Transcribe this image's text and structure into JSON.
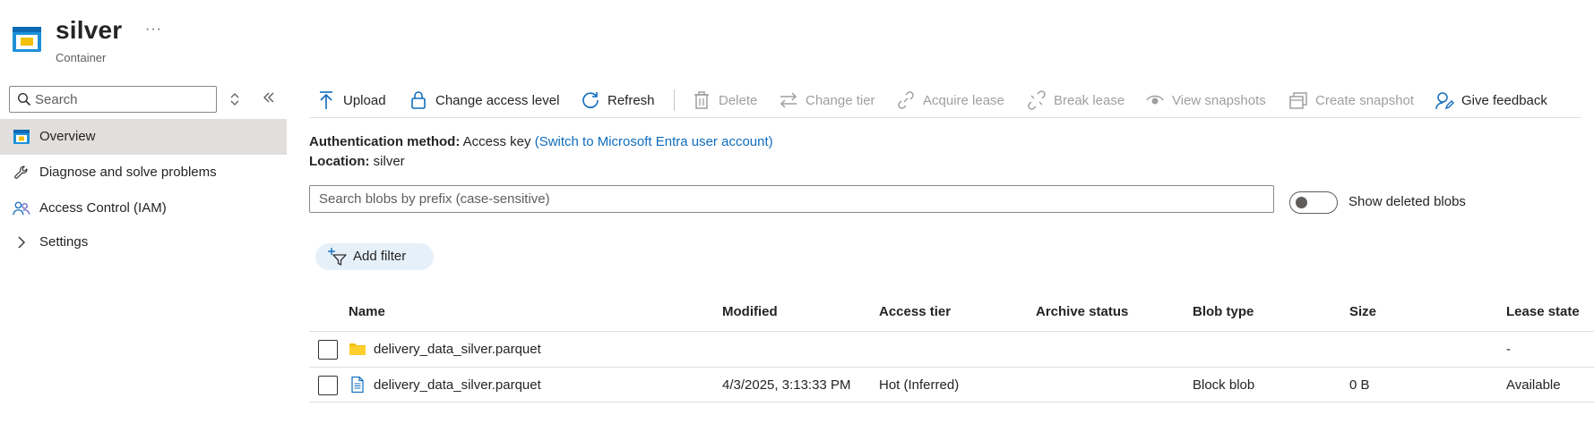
{
  "header": {
    "title": "silver",
    "subtitle": "Container",
    "more": "···"
  },
  "sidebar": {
    "search_placeholder": "Search",
    "items": [
      {
        "label": "Overview",
        "icon": "container-icon",
        "active": true
      },
      {
        "label": "Diagnose and solve problems",
        "icon": "wrench-icon"
      },
      {
        "label": "Access Control (IAM)",
        "icon": "people-icon"
      },
      {
        "label": "Settings",
        "icon": "chevron-right-icon"
      }
    ]
  },
  "toolbar": {
    "upload": "Upload",
    "change_access": "Change access level",
    "refresh": "Refresh",
    "delete": "Delete",
    "change_tier": "Change tier",
    "acquire_lease": "Acquire lease",
    "break_lease": "Break lease",
    "view_snapshots": "View snapshots",
    "create_snapshot": "Create snapshot",
    "give_feedback": "Give feedback"
  },
  "info": {
    "auth_label": "Authentication method:",
    "auth_value": "Access key",
    "auth_link": "(Switch to Microsoft Entra user account)",
    "location_label": "Location:",
    "location_value": "silver"
  },
  "blob_search": {
    "placeholder": "Search blobs by prefix (case-sensitive)",
    "show_deleted_label": "Show deleted blobs"
  },
  "filter": {
    "add_filter": "Add filter"
  },
  "table": {
    "columns": [
      "Name",
      "Modified",
      "Access tier",
      "Archive status",
      "Blob type",
      "Size",
      "Lease state"
    ],
    "rows": [
      {
        "type": "folder",
        "name": "delivery_data_silver.parquet",
        "modified": "",
        "access_tier": "",
        "archive_status": "",
        "blob_type": "",
        "size": "",
        "lease_state": "-"
      },
      {
        "type": "file",
        "name": "delivery_data_silver.parquet",
        "modified": "4/3/2025, 3:13:33 PM",
        "access_tier": "Hot (Inferred)",
        "archive_status": "",
        "blob_type": "Block blob",
        "size": "0 B",
        "lease_state": "Available"
      }
    ]
  },
  "colors": {
    "accent": "#0f6cbd",
    "folder": "#f2c10e",
    "active_bg": "#e1dfdd",
    "filter_bg": "#e6f0f9"
  }
}
